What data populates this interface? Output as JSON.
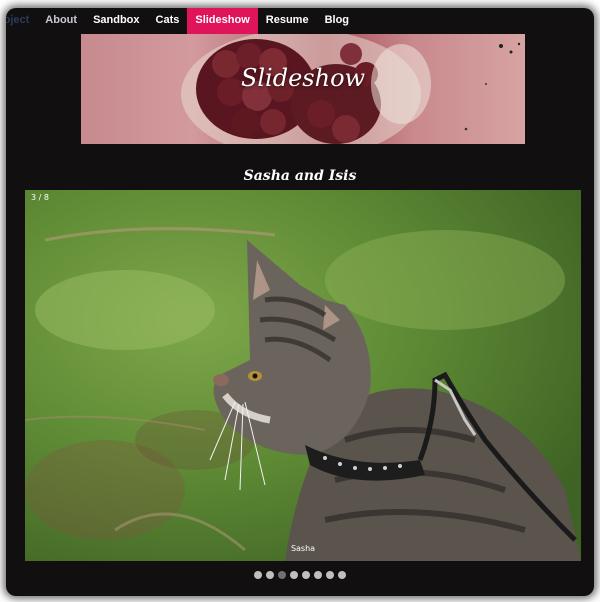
{
  "nav": {
    "items": [
      {
        "label": "Project",
        "state": "clipped"
      },
      {
        "label": "About",
        "state": "muted"
      },
      {
        "label": "Sandbox",
        "state": "normal"
      },
      {
        "label": "Cats",
        "state": "normal"
      },
      {
        "label": "Slideshow",
        "state": "active"
      },
      {
        "label": "Resume",
        "state": "normal"
      },
      {
        "label": "Blog",
        "state": "normal"
      }
    ]
  },
  "hero": {
    "title": "Slideshow"
  },
  "slideshow": {
    "heading": "Sasha and Isis",
    "counter": "3 / 8",
    "caption": "Sasha",
    "total": 8,
    "current": 3
  },
  "colors": {
    "background": "#120f10",
    "active_nav": "#e0145a",
    "dot": "#bfbfbf",
    "dot_active": "#717171"
  }
}
